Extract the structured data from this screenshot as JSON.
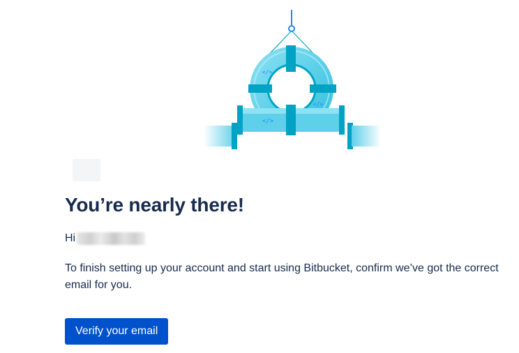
{
  "hero": {
    "image_name": "pipe-ring-illustration",
    "code_glyph": "</>"
  },
  "content": {
    "heading": "You’re nearly there!",
    "greeting_prefix": "Hi",
    "message": "To finish setting up your account and start using Bitbucket, confirm we’ve got the correct email for you.",
    "cta_label": "Verify your email"
  },
  "colors": {
    "text": "#172b4d",
    "primary_button": "#0052cc",
    "pipe_light": "#7fdcf0",
    "pipe_mid": "#35c2e2",
    "pipe_dark": "#00a3c4",
    "hanger_blue": "#2684ff"
  }
}
